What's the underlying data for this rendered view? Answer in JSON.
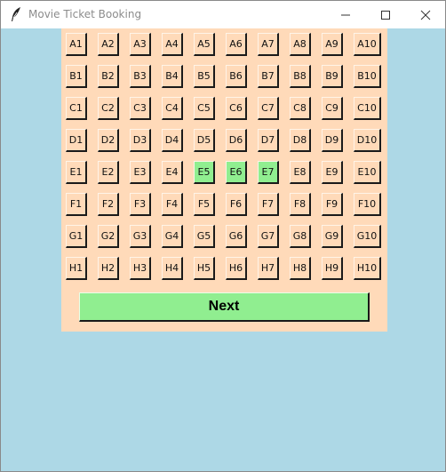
{
  "window": {
    "title": "Movie Ticket Booking",
    "icon": "feather-icon",
    "controls": [
      "minimize-icon",
      "maximize-icon",
      "close-icon"
    ]
  },
  "seating": {
    "rows": [
      [
        "A1",
        "A2",
        "A3",
        "A4",
        "A5",
        "A6",
        "A7",
        "A8",
        "A9",
        "A10"
      ],
      [
        "B1",
        "B2",
        "B3",
        "B4",
        "B5",
        "B6",
        "B7",
        "B8",
        "B9",
        "B10"
      ],
      [
        "C1",
        "C2",
        "C3",
        "C4",
        "C5",
        "C6",
        "C7",
        "C8",
        "C9",
        "C10"
      ],
      [
        "D1",
        "D2",
        "D3",
        "D4",
        "D5",
        "D6",
        "D7",
        "D8",
        "D9",
        "D10"
      ],
      [
        "E1",
        "E2",
        "E3",
        "E4",
        "E5",
        "E6",
        "E7",
        "E8",
        "E9",
        "E10"
      ],
      [
        "F1",
        "F2",
        "F3",
        "F4",
        "F5",
        "F6",
        "F7",
        "F8",
        "F9",
        "F10"
      ],
      [
        "G1",
        "G2",
        "G3",
        "G4",
        "G5",
        "G6",
        "G7",
        "G8",
        "G9",
        "G10"
      ],
      [
        "H1",
        "H2",
        "H3",
        "H4",
        "H5",
        "H6",
        "H7",
        "H8",
        "H9",
        "H10"
      ]
    ],
    "selected": [
      "E5",
      "E6",
      "E7"
    ]
  },
  "next_button": {
    "label": "Next"
  },
  "colors": {
    "window_bg": "#add8e6",
    "panel_bg": "#ffdab9",
    "seat_bg": "#ffdab9",
    "selected_seat_bg": "#90ee90",
    "next_bg": "#90ee90"
  }
}
